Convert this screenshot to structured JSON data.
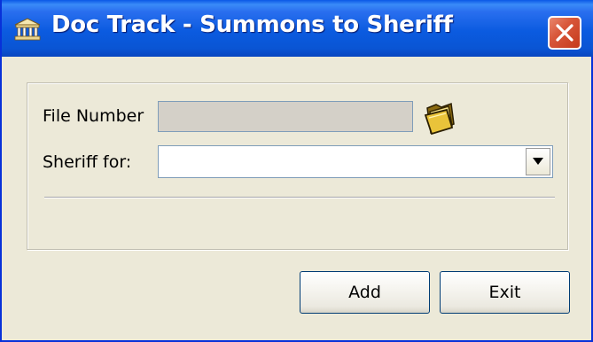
{
  "window": {
    "title": "Doc Track - Summons to Sheriff",
    "icon": "building-columns-icon",
    "close_icon": "close-icon"
  },
  "form": {
    "file_number_label": "File Number",
    "file_number_value": "",
    "browse_icon": "folder-icon",
    "sheriff_label": "Sheriff for:",
    "sheriff_selected": "",
    "dropdown_icon": "chevron-down-icon"
  },
  "buttons": {
    "add_label": "Add",
    "exit_label": "Exit"
  },
  "colors": {
    "titlebar": "#0a55d4",
    "window_bg": "#ece9d8",
    "close_button": "#d8573a",
    "disabled_field": "#d4d0c8"
  }
}
